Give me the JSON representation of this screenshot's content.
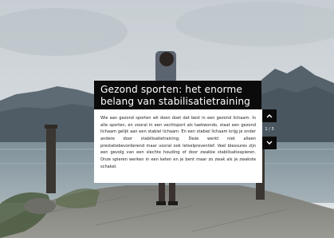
{
  "article": {
    "title": "Gezond sporten: het enorme belang van stabilisatietraining",
    "body": "Wie aan gezond sporten wil doen doet dat best in een gezond lichaam. In alle sporten, en vooral in een vechtsport als taekwondo, staat een gezond lichaam gelijk aan een stabiel lichaam. En een stabiel lichaam krijg je onder andere door stabilisatietraining. Deze werkt niet alleen prestatiebevorderend maar vooral ook letselpreventief. Veel blessures zijn een gevolg van een slechte houding of door zwakke stabilisatiespieren. Onze spieren werken in een keten en je bent maar zo zwak als je zwakste schakel."
  },
  "pager": {
    "counter": "1 / 3",
    "prev_icon": "chevron-up-icon",
    "next_icon": "chevron-down-icon"
  },
  "background": {
    "scene": "man-on-pier-at-lake-with-mountains",
    "colors": {
      "sky": "#c9d0d5",
      "mountain": "#55626c",
      "water": "#8e9ea6",
      "pier": "#8a8a86",
      "panel": "#0b0b0b",
      "panel_text": "#ffffff"
    }
  }
}
